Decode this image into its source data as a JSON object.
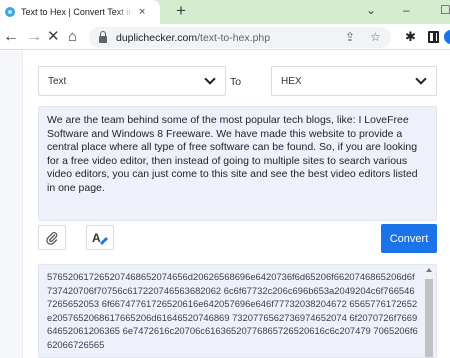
{
  "browser": {
    "tab_title": "Text to Hex | Convert Text into Hex",
    "tab_close": "×",
    "new_tab": "+",
    "url_domain": "duplichecker.com",
    "url_path": "/text-to-hex.php",
    "caption_chevron": "⌄",
    "caption_minimize": "–",
    "caption_maximize": "☐"
  },
  "converter": {
    "from_select": "Text",
    "to_label": "To",
    "to_select": "HEX",
    "input_text": "We are the team behind some of the most popular tech blogs, like: I LoveFree Software and Windows 8 Freeware. We have made this website to provide a central place where all type of free software can be found. So, if you are looking for a free video editor, then instead of going to multiple sites to search various video editors, you can just come to this site and see the best video editors listed in one page.",
    "convert_label": "Convert",
    "output_text": "576520617265207468652074656d20626568696e6420736f6d65206f6620746865206d6f737420706f70756c617220746563682062 6c6f67732c206c696b653a2049204c6f7665467265652053 6f66747761726520616e642057696e646f77732038204672 6565776172652e2057652068617665206d61646520746869 7320776562736974652074 6f2070726f766964652061206365 6e7472616c20706c61636520776865726520616c6c207479 7065206f662066726565"
  },
  "colors": {
    "accent": "#1a73e8",
    "tabstrip": "#d4edcf",
    "textarea_bg": "#eef1f9"
  }
}
